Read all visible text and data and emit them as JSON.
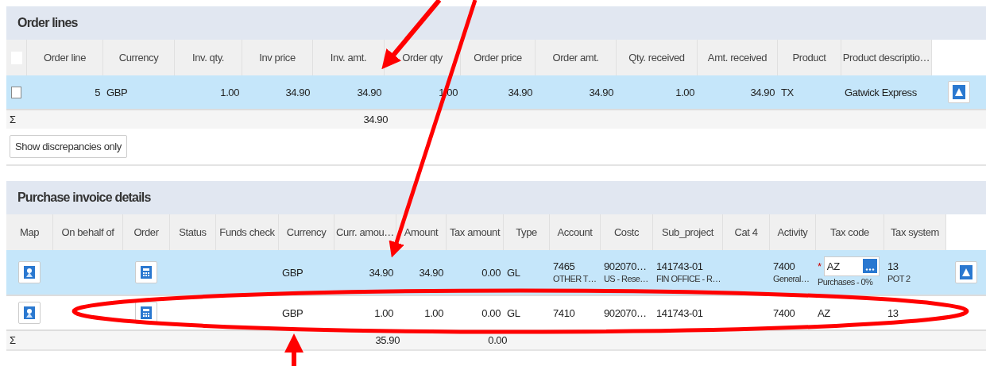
{
  "order_lines": {
    "title": "Order lines",
    "columns": [
      {
        "label": "Order line"
      },
      {
        "label": "Currency"
      },
      {
        "label": "Inv. qty."
      },
      {
        "label": "Inv price"
      },
      {
        "label": "Inv. amt.",
        "total": "34.90"
      },
      {
        "label": "Order qty"
      },
      {
        "label": "Order price"
      },
      {
        "label": "Order amt."
      },
      {
        "label": "Qty. received"
      },
      {
        "label": "Amt. received"
      },
      {
        "label": "Product"
      },
      {
        "label": "Product descriptio…"
      }
    ],
    "sum_symbol": "Σ",
    "all_checked": false,
    "rows": [
      {
        "selected": true,
        "checked": false,
        "cells": [
          "5",
          "GBP",
          "1.00",
          "34.90",
          "34.90",
          "1.00",
          "34.90",
          "34.90",
          "1.00",
          "34.90",
          "TX",
          "Gatwick Express"
        ]
      }
    ],
    "button": "Show discrepancies only"
  },
  "purchase_invoice_details": {
    "title": "Purchase invoice details",
    "columns": [
      {
        "label": "Map"
      },
      {
        "label": "On behalf of"
      },
      {
        "label": "Order"
      },
      {
        "label": "Status"
      },
      {
        "label": "Funds check"
      },
      {
        "label": "Currency"
      },
      {
        "label": "Curr. amou…",
        "total": "35.90"
      },
      {
        "label": "Amount"
      },
      {
        "label": "Tax amount",
        "total": "0.00"
      },
      {
        "label": "Type"
      },
      {
        "label": "Account"
      },
      {
        "label": "Costc"
      },
      {
        "label": "Sub_project"
      },
      {
        "label": "Cat 4"
      },
      {
        "label": "Activity"
      },
      {
        "label": "Tax code"
      },
      {
        "label": "Tax system"
      }
    ],
    "sum_symbol": "Σ",
    "rows": [
      {
        "selected": true,
        "currency": "GBP",
        "curr_amount": "34.90",
        "amount": "34.90",
        "tax_amount": "0.00",
        "type": "GL",
        "account": {
          "text": "7465",
          "sub": "OTHER T…"
        },
        "costc": {
          "text": "902070…",
          "sub": "US - Rese…"
        },
        "sub_project": {
          "text": "141743-01",
          "sub": "FIN OFFICE - R…"
        },
        "activity": {
          "text": "7400",
          "sub": "General…"
        },
        "tax_code": {
          "kind": "field",
          "value": "AZ",
          "required_mark": "*",
          "sub": "Purchases - 0%"
        },
        "tax_system": {
          "text": "13",
          "sub": "POT 2"
        }
      },
      {
        "selected": false,
        "currency": "GBP",
        "curr_amount": "1.00",
        "amount": "1.00",
        "tax_amount": "0.00",
        "type": "GL",
        "account": {
          "text": "7410"
        },
        "costc": {
          "text": "902070…"
        },
        "sub_project": {
          "text": "141743-01"
        },
        "activity": {
          "text": "7400"
        },
        "tax_code": {
          "kind": "text",
          "value": "AZ"
        },
        "tax_system": {
          "text": "13"
        }
      }
    ]
  }
}
